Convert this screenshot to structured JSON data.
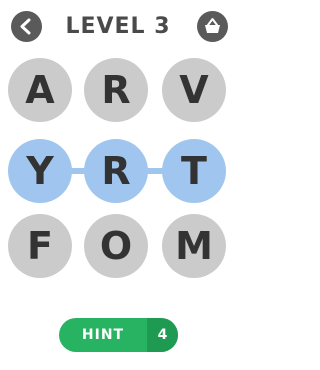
{
  "header": {
    "title": "LEVEL 3",
    "back_icon": "chevron-left-icon",
    "shop_icon": "basket-icon"
  },
  "board": {
    "rows": [
      [
        {
          "letter": "A",
          "selected": false
        },
        {
          "letter": "R",
          "selected": false
        },
        {
          "letter": "V",
          "selected": false
        }
      ],
      [
        {
          "letter": "Y",
          "selected": true
        },
        {
          "letter": "R",
          "selected": true
        },
        {
          "letter": "T",
          "selected": true
        }
      ],
      [
        {
          "letter": "F",
          "selected": false
        },
        {
          "letter": "O",
          "selected": false
        },
        {
          "letter": "M",
          "selected": false
        }
      ]
    ]
  },
  "hint": {
    "label": "HINT",
    "count": "4"
  },
  "colors": {
    "tile": "#cbcbcb",
    "tile_selected": "#a0c6ef",
    "hint_green": "#27b361",
    "header_icon_bg": "#5a5a5a"
  }
}
